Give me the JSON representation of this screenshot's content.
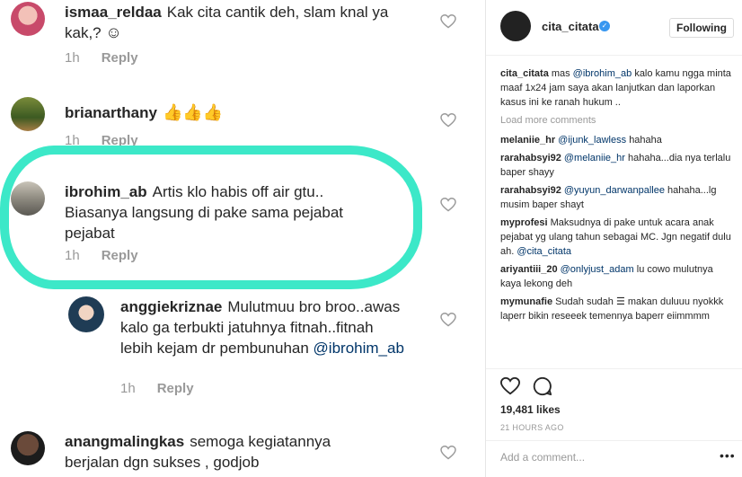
{
  "thread": {
    "comments": [
      {
        "user": "ismaa_reldaa",
        "text": "Kak cita cantik deh, slam knal ya kak,?",
        "emoji": "☺",
        "time": "1h",
        "reply": "Reply"
      },
      {
        "user": "brianarthany",
        "text": "",
        "emoji": "👍👍👍",
        "time": "1h",
        "reply": "Reply"
      },
      {
        "user": "ibrohim_ab",
        "text": "Artis klo habis off air gtu.. Biasanya langsung di pake sama pejabat pejabat",
        "time": "1h",
        "reply": "Reply"
      },
      {
        "user": "anggiekriznae",
        "text": "Mulutmuu bro broo..awas kalo ga terbukti jatuhnya fitnah..fitnah lebih kejam dr pembunuhan",
        "mention": "@ibrohim_ab",
        "time": "1h",
        "reply": "Reply"
      },
      {
        "user": "anangmalingkas",
        "text": "semoga kegiatannya berjalan dgn sukses , godjob"
      }
    ]
  },
  "post": {
    "username": "cita_citata",
    "verified_mark": "✓",
    "follow_label": "Following",
    "load_more": "Load more comments",
    "caption": {
      "user": "cita_citata",
      "pre": "mas",
      "mention": "@ibrohim_ab",
      "post": "kalo kamu ngga minta maaf 1x24 jam saya akan lanjutkan dan laporkan kasus ini ke ranah hukum .."
    },
    "comments": [
      {
        "user": "melaniie_hr",
        "mention": "@ijunk_lawless",
        "text": "hahaha"
      },
      {
        "user": "rarahabsyi92",
        "mention": "@melaniie_hr",
        "text": "hahaha...dia nya terlalu baper shayy"
      },
      {
        "user": "rarahabsyi92",
        "mention": "@yuyun_darwanpallee",
        "text": "hahaha...lg musim baper shayt"
      },
      {
        "user": "myprofesi",
        "text": "Maksudnya di pake untuk acara anak pejabat yg ulang tahun sebagai MC. Jgn negatif dulu ah.",
        "mention": "@cita_citata"
      },
      {
        "user": "ariyantiii_20",
        "mention": "@onlyjust_adam",
        "text": "lu cowo mulutnya kaya lekong deh"
      },
      {
        "user": "mymunafie",
        "text": "Sudah sudah ☰ makan duluuu nyokkk laperr bikin reseeek temennya baperr eiimmmm"
      }
    ],
    "likes": "19,481 likes",
    "time_ago": "21 HOURS AGO",
    "add_comment_placeholder": "Add a comment...",
    "more": "•••"
  },
  "colors": {
    "highlight": "#3ce8c8",
    "link": "#003569",
    "muted": "#999999",
    "verified": "#3897f0"
  },
  "icons": [
    "heart-icon",
    "comment-icon",
    "more-icon"
  ]
}
